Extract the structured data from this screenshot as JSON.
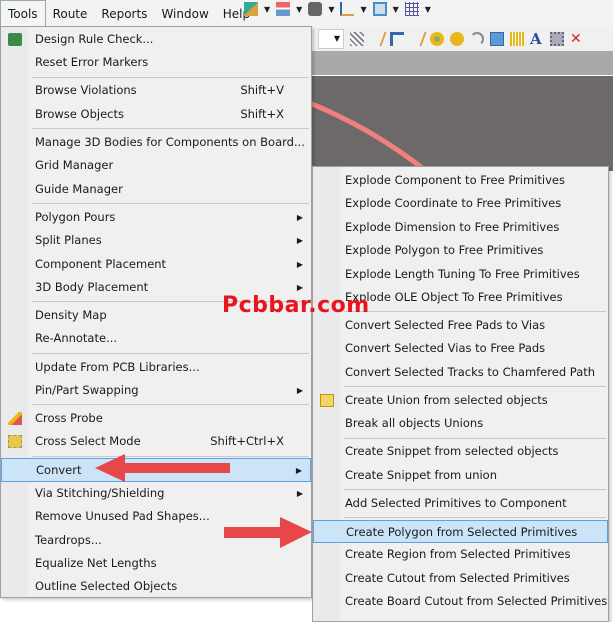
{
  "menubar": {
    "items": [
      "Tools",
      "Route",
      "Reports",
      "Window",
      "Help"
    ]
  },
  "tools_menu": {
    "groups": [
      [
        {
          "label": "Design Rule Check...",
          "icon": "drc-icon"
        },
        {
          "label": "Reset Error Markers"
        }
      ],
      [
        {
          "label": "Browse Violations",
          "shortcut": "Shift+V"
        },
        {
          "label": "Browse Objects",
          "shortcut": "Shift+X"
        }
      ],
      [
        {
          "label": "Manage 3D Bodies for Components on Board..."
        },
        {
          "label": "Grid Manager"
        },
        {
          "label": "Guide Manager"
        }
      ],
      [
        {
          "label": "Polygon Pours",
          "submenu": true
        },
        {
          "label": "Split Planes",
          "submenu": true
        },
        {
          "label": "Component Placement",
          "submenu": true
        },
        {
          "label": "3D Body Placement",
          "submenu": true
        }
      ],
      [
        {
          "label": "Density Map"
        },
        {
          "label": "Re-Annotate..."
        }
      ],
      [
        {
          "label": "Update From PCB Libraries..."
        },
        {
          "label": "Pin/Part Swapping",
          "submenu": true
        }
      ],
      [
        {
          "label": "Cross Probe",
          "icon": "cross-probe-icon"
        },
        {
          "label": "Cross Select Mode",
          "shortcut": "Shift+Ctrl+X",
          "icon": "cross-select-icon"
        }
      ],
      [
        {
          "label": "Convert",
          "submenu": true,
          "highlighted": true
        },
        {
          "label": "Via Stitching/Shielding",
          "submenu": true
        },
        {
          "label": "Remove Unused Pad Shapes..."
        },
        {
          "label": "Teardrops..."
        },
        {
          "label": "Equalize Net Lengths"
        },
        {
          "label": "Outline Selected Objects"
        }
      ]
    ]
  },
  "convert_submenu": {
    "groups": [
      [
        {
          "label": "Explode Component to Free Primitives"
        },
        {
          "label": "Explode Coordinate to Free Primitives"
        },
        {
          "label": "Explode Dimension to Free Primitives"
        },
        {
          "label": "Explode Polygon to Free Primitives"
        },
        {
          "label": "Explode Length Tuning To Free Primitives"
        },
        {
          "label": "Explode OLE Object To Free Primitives"
        }
      ],
      [
        {
          "label": "Convert Selected Free Pads to Vias"
        },
        {
          "label": "Convert Selected Vias to Free Pads"
        },
        {
          "label": "Convert Selected Tracks to Chamfered Path"
        }
      ],
      [
        {
          "label": "Create Union from selected objects",
          "icon": "union-icon"
        },
        {
          "label": "Break all objects Unions"
        }
      ],
      [
        {
          "label": "Create Snippet from selected objects"
        },
        {
          "label": "Create Snippet from union"
        }
      ],
      [
        {
          "label": "Add Selected Primitives to Component"
        }
      ],
      [
        {
          "label": "Create Polygon from Selected Primitives",
          "highlighted": true
        },
        {
          "label": "Create Region from Selected Primitives"
        },
        {
          "label": "Create Cutout from Selected Primitives"
        },
        {
          "label": "Create Board Cutout from Selected Primitives"
        }
      ]
    ]
  },
  "watermark": "Pcbbar.com",
  "colors": {
    "highlight": "#cce4f7",
    "highlight_border": "#5ea0e0",
    "arrow": "#e8474a",
    "watermark": "#e8141e",
    "canvas": "#6d6968",
    "trace": "#f08080"
  }
}
